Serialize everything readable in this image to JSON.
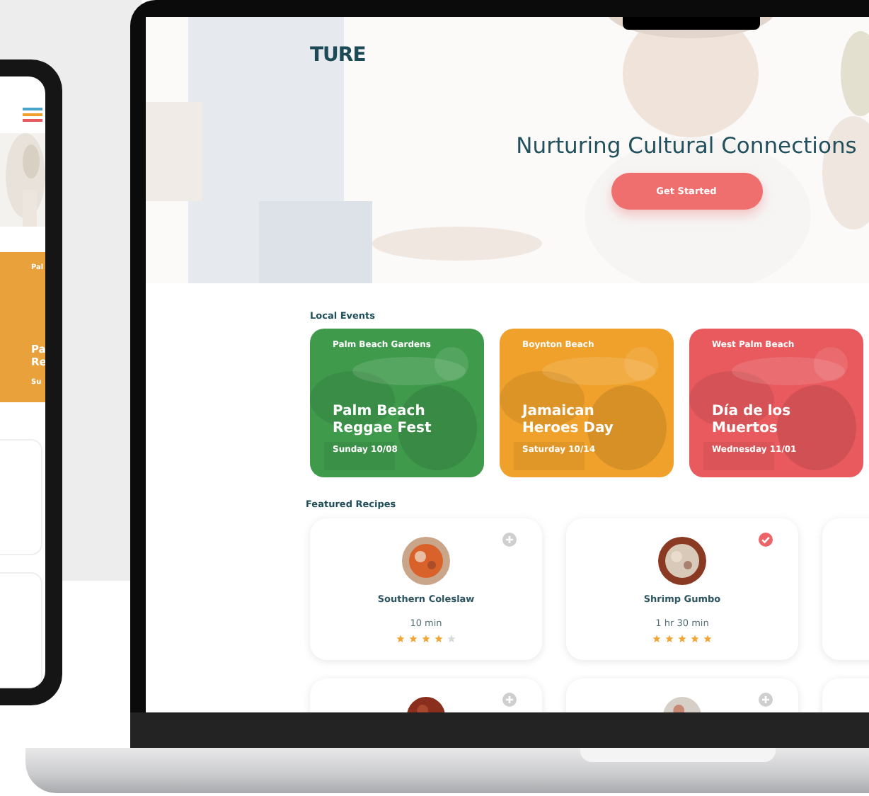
{
  "phone": {
    "card": {
      "location": "Pal",
      "title_lines": [
        "Pa",
        "Re"
      ],
      "date": "Su",
      "color": "#e9a23b"
    }
  },
  "logo": "TURE",
  "hero": {
    "title": "Nurturing Cultural Connections",
    "button": "Get Started"
  },
  "events_heading": "Local Events",
  "events": [
    {
      "location": "Palm Beach Gardens",
      "title_lines": [
        "Palm Beach",
        "Reggae Fest"
      ],
      "date": "Sunday 10/08",
      "color": "#3f9a4c"
    },
    {
      "location": "Boynton Beach",
      "title_lines": [
        "Jamaican",
        "Heroes Day"
      ],
      "date": "Saturday 10/14",
      "color": "#f0a12b"
    },
    {
      "location": "West Palm Beach",
      "title_lines": [
        "Día de los",
        "Muertos"
      ],
      "date": "Wednesday 11/01",
      "color": "#e85a5e"
    }
  ],
  "recipes_heading": "Featured Recipes",
  "recipes": [
    {
      "name": "Southern Coleslaw",
      "time": "10 min",
      "stars": 4,
      "saved": false
    },
    {
      "name": "Shrimp Gumbo",
      "time": "1 hr 30 min",
      "stars": 5,
      "saved": true
    }
  ],
  "recipes_row2": [
    {
      "saved": false
    },
    {
      "saved": false
    }
  ]
}
